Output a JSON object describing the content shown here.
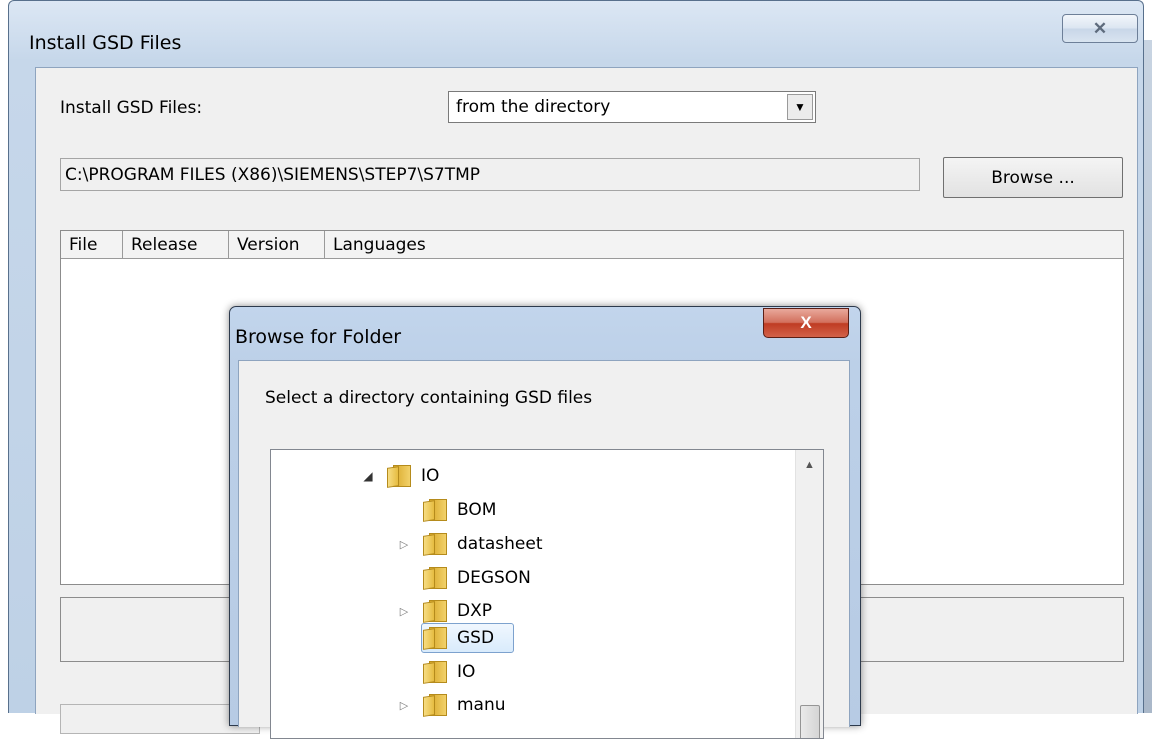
{
  "main_window": {
    "title": "Install GSD Files",
    "close_glyph": "✕",
    "install_label": "Install GSD Files:",
    "source_combo": {
      "value": "from the directory",
      "arrow": "▼"
    },
    "path": "C:\\PROGRAM FILES (X86)\\SIEMENS\\STEP7\\S7TMP",
    "browse_button": "Browse ...",
    "columns": [
      "File",
      "Release",
      "Version",
      "Languages"
    ]
  },
  "browse_dialog": {
    "title": "Browse for Folder",
    "close_glyph": "X",
    "description": "Select a directory containing GSD files",
    "tree": [
      {
        "label": "IO",
        "expander": "◢",
        "expanded": true
      },
      {
        "label": "BOM",
        "expander": ""
      },
      {
        "label": "datasheet",
        "expander": "▷"
      },
      {
        "label": "DEGSON",
        "expander": ""
      },
      {
        "label": "DXP",
        "expander": "▷"
      },
      {
        "label": "GSD",
        "expander": "",
        "selected": true
      },
      {
        "label": "IO",
        "expander": ""
      },
      {
        "label": "manu",
        "expander": "▷"
      }
    ],
    "scroll_up_glyph": "▲"
  },
  "icons": {
    "folder": "folder-icon",
    "expand": "expand-arrow-icon",
    "collapse": "collapse-arrow-icon"
  }
}
